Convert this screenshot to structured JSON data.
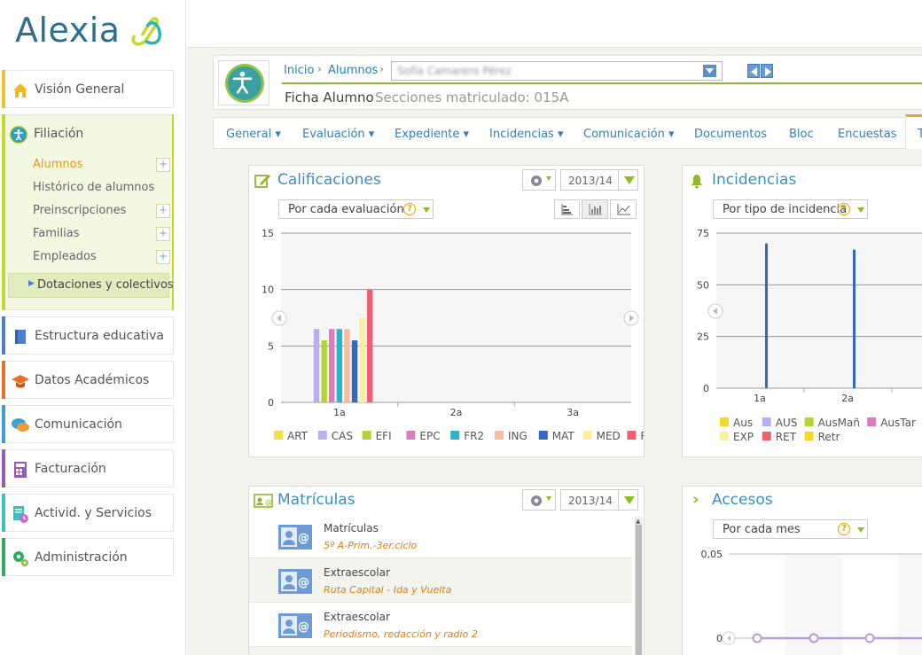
{
  "app": {
    "logo": "Alexia"
  },
  "sidebar": {
    "items": [
      {
        "label": "Visión General",
        "color": "#f2c12e",
        "icon": "home-icon"
      },
      {
        "label": "Filiación",
        "color": "#c6d92b",
        "icon": "accessibility-icon"
      },
      {
        "label": "Estructura educativa",
        "color": "#4a7fd0",
        "icon": "book-icon"
      },
      {
        "label": "Datos Académicos",
        "color": "#e8702a",
        "icon": "graduation-cap-icon"
      },
      {
        "label": "Comunicación",
        "color": "#3aa0d8",
        "icon": "chat-icon"
      },
      {
        "label": "Facturación",
        "color": "#9b59b6",
        "icon": "calculator-icon"
      },
      {
        "label": "Activid. y Servicios",
        "color": "#3bbfbf",
        "icon": "clipboard-clock-icon"
      },
      {
        "label": "Administración",
        "color": "#2eaa5c",
        "icon": "gears-icon"
      }
    ],
    "filiacion_sub": [
      "Alumnos",
      "Histórico de alumnos",
      "Preinscripciones",
      "Familias",
      "Empleados",
      "Dotaciones y colectivos"
    ],
    "plus": "+"
  },
  "header": {
    "breadcrumb": [
      "Inicio",
      "Alumnos"
    ],
    "student_name": "Sofía Camarero Pérez",
    "title": "Ficha Alumno",
    "secciones": "Secciones matriculado: 015A"
  },
  "tabs": [
    "General",
    "Evaluación",
    "Expediente",
    "Incidencias",
    "Comunicación",
    "Documentos",
    "Bloc",
    "Encuestas",
    "T"
  ],
  "calificaciones": {
    "title": "Calificaciones",
    "year": "2013/14",
    "filter": "Por cada evaluación",
    "help": "?",
    "chart_data": {
      "type": "bar",
      "categories": [
        "1a",
        "2a",
        "3a"
      ],
      "yticks": [
        "15",
        "10",
        "5",
        "0"
      ],
      "ylim": [
        0,
        15
      ],
      "series": [
        {
          "name": "ART",
          "color": "#f5e04a",
          "values": [
            0,
            0,
            0
          ]
        },
        {
          "name": "CAS",
          "color": "#b9aef0",
          "values": [
            6.5,
            0,
            0
          ]
        },
        {
          "name": "EFI",
          "color": "#b5d334",
          "values": [
            5.5,
            0,
            0
          ]
        },
        {
          "name": "EPC",
          "color": "#e07ac0",
          "values": [
            6.5,
            0,
            0
          ]
        },
        {
          "name": "FR2",
          "color": "#2eb4c8",
          "values": [
            6.5,
            0,
            0
          ]
        },
        {
          "name": "ING",
          "color": "#f5bf9f",
          "values": [
            6.5,
            0,
            0
          ]
        },
        {
          "name": "MAT",
          "color": "#3468c0",
          "values": [
            5.5,
            0,
            0
          ]
        },
        {
          "name": "MED",
          "color": "#faf0a0",
          "values": [
            7.5,
            0,
            0
          ]
        },
        {
          "name": "REL",
          "color": "#f06070",
          "values": [
            10,
            0,
            0
          ]
        }
      ]
    }
  },
  "incidencias": {
    "title": "Incidencias",
    "filter": "Por tipo de incidencia",
    "help": "?",
    "chart_data": {
      "type": "bar",
      "categories": [
        "1a",
        "2a"
      ],
      "yticks": [
        "75",
        "50",
        "25",
        "0"
      ],
      "ylim": [
        0,
        75
      ],
      "series": [
        {
          "name": "Aus",
          "color": "#f5d82a",
          "values": [
            0,
            0
          ]
        },
        {
          "name": "AUS",
          "color": "#b9aef0",
          "values": [
            0,
            0
          ]
        },
        {
          "name": "AusMañ",
          "color": "#b5d334",
          "values": [
            0,
            0
          ]
        },
        {
          "name": "AusTar",
          "color": "#e07ac0",
          "values": [
            0,
            0
          ]
        },
        {
          "name": "EXP",
          "color": "#faf0a0",
          "values": [
            0,
            0
          ]
        },
        {
          "name": "RET",
          "color": "#f06070",
          "values": [
            70,
            67
          ]
        },
        {
          "name": "Retr",
          "color": "#f5d82a",
          "values": [
            0,
            0
          ]
        }
      ]
    }
  },
  "matriculas": {
    "title": "Matrículas",
    "year": "2013/14",
    "rows": [
      {
        "title": "Matrículas",
        "subtitle": "5º A-Prim.-3er.ciclo"
      },
      {
        "title": "Extraescolar",
        "subtitle": "Ruta Capital - Ida y Vuelta"
      },
      {
        "title": "Extraescolar",
        "subtitle": "Periodismo, redacción y radio 2"
      }
    ]
  },
  "accesos": {
    "title": "Accesos",
    "filter": "Por cada mes",
    "help": "?",
    "chart_data": {
      "type": "line",
      "yticks": [
        "0,05",
        "0"
      ],
      "ylim": [
        0,
        0.05
      ],
      "series": [
        {
          "color": "#b39ddb",
          "values": [
            0,
            0,
            0,
            0
          ]
        }
      ]
    }
  }
}
